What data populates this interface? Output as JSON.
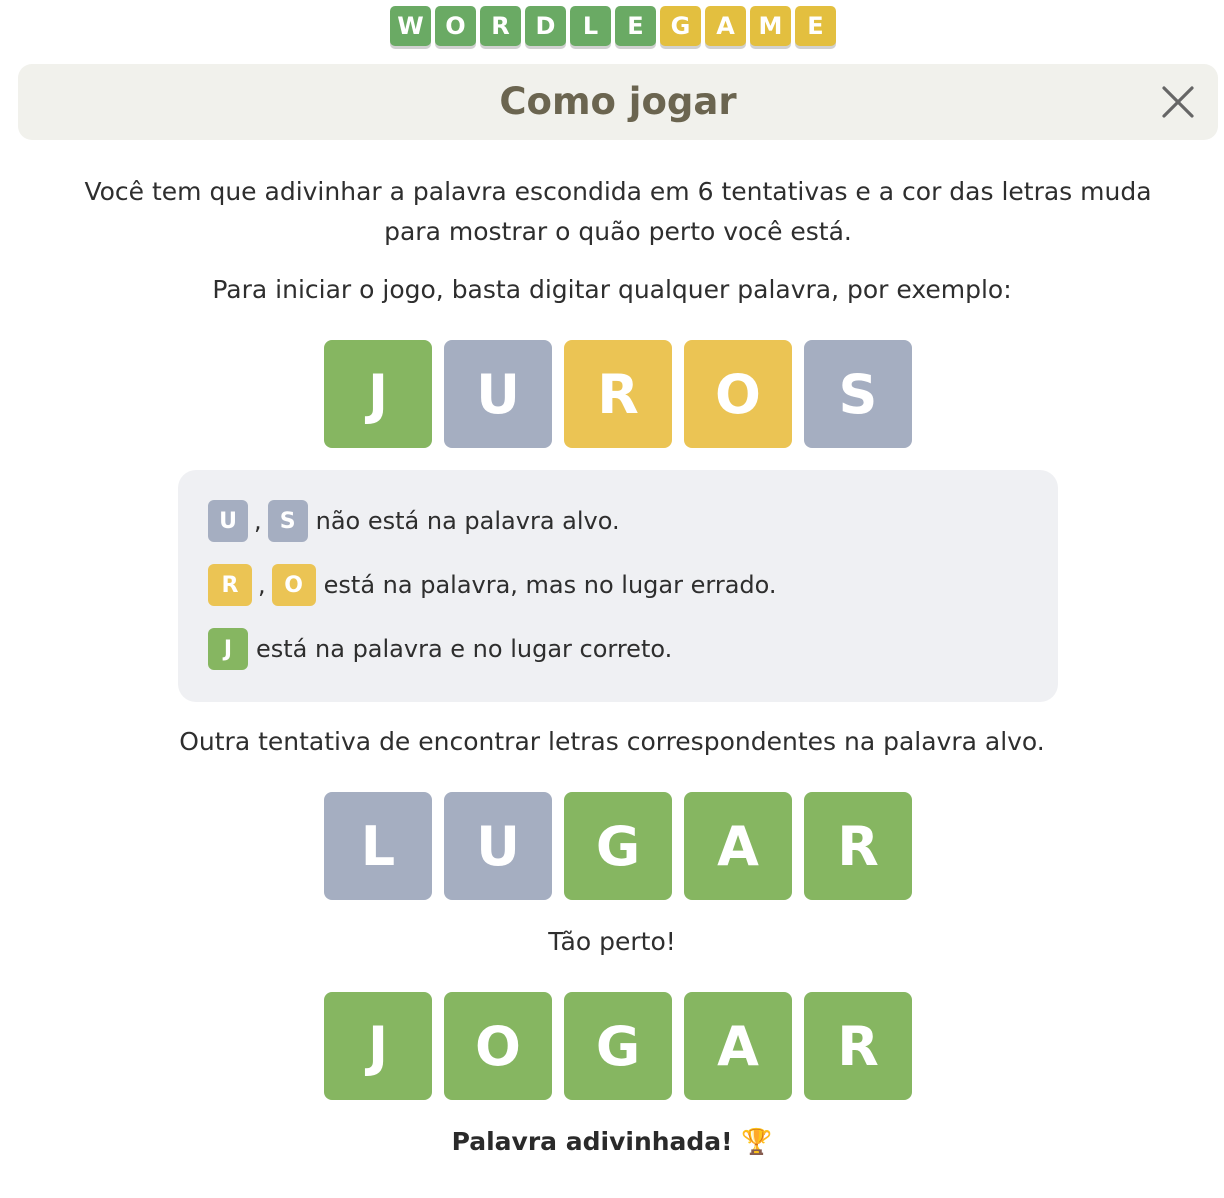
{
  "logo": {
    "tiles": [
      {
        "letter": "W",
        "color": "#6aaa64"
      },
      {
        "letter": "O",
        "color": "#6aaa64"
      },
      {
        "letter": "R",
        "color": "#6aaa64"
      },
      {
        "letter": "D",
        "color": "#6aaa64"
      },
      {
        "letter": "L",
        "color": "#6aaa64"
      },
      {
        "letter": "E",
        "color": "#6aaa64"
      },
      {
        "letter": "G",
        "color": "#e3bf3f"
      },
      {
        "letter": "A",
        "color": "#e3bf3f"
      },
      {
        "letter": "M",
        "color": "#e3bf3f"
      },
      {
        "letter": "E",
        "color": "#e3bf3f"
      }
    ]
  },
  "header": {
    "title": "Como jogar",
    "close_icon": "close-icon"
  },
  "content": {
    "intro": "Você tem que adivinhar a palavra escondida em 6 tentativas e a cor das letras muda para mostrar o quão perto você está.",
    "start_text": "Para iniciar o jogo, basta digitar qualquer palavra, por exemplo:",
    "example1": [
      "J",
      "U",
      "R",
      "O",
      "S"
    ],
    "legend": {
      "absent_letters": [
        "U",
        "S"
      ],
      "absent_text": "não está na palavra alvo.",
      "present_letters": [
        "R",
        "O"
      ],
      "present_text": "está na palavra, mas no lugar errado.",
      "correct_letters": [
        "J"
      ],
      "correct_text": "está na palavra e no lugar correto.",
      "separator": ","
    },
    "another_text": "Outra tentativa de encontrar letras correspondentes na palavra alvo.",
    "example2": [
      "L",
      "U",
      "G",
      "A",
      "R"
    ],
    "close_text": "Tão perto!",
    "example3": [
      "J",
      "O",
      "G",
      "A",
      "R"
    ],
    "guessed_text": "Palavra adivinhada! 🏆"
  },
  "colors": {
    "correct": "#86b661",
    "present": "#ebc454",
    "absent": "#a5aec1",
    "header_bg": "#f1f1ec",
    "legend_bg": "#eff0f3"
  }
}
